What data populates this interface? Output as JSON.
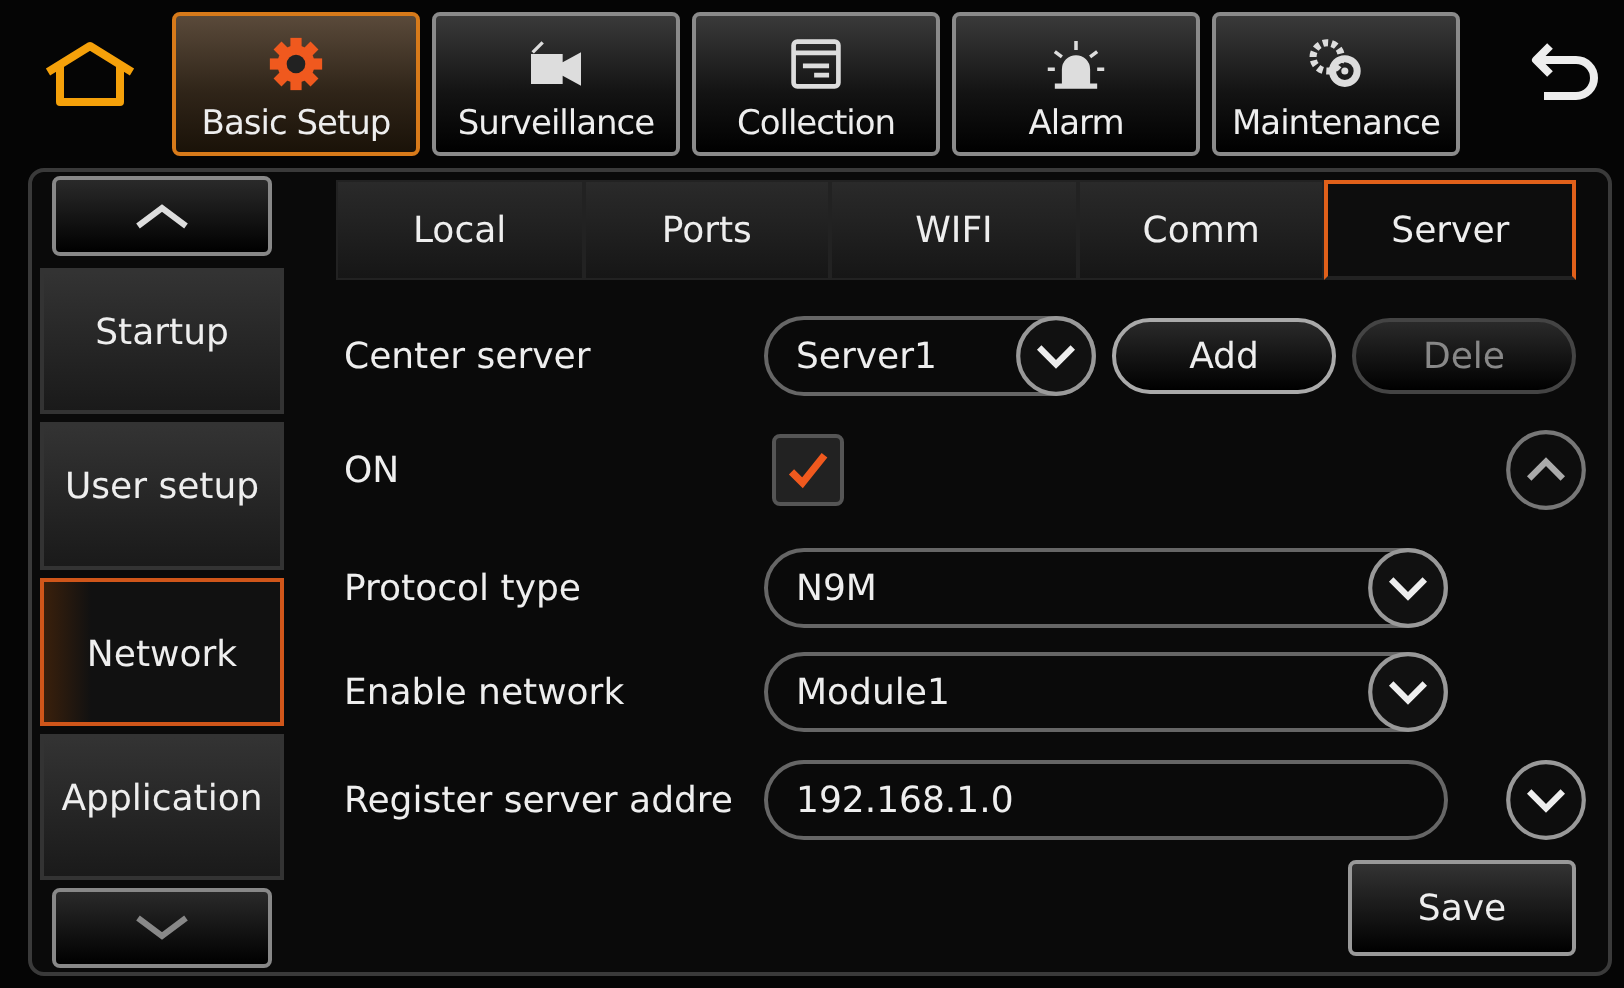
{
  "nav": [
    {
      "label": "Basic Setup",
      "selected": true
    },
    {
      "label": "Surveillance",
      "selected": false
    },
    {
      "label": "Collection",
      "selected": false
    },
    {
      "label": "Alarm",
      "selected": false
    },
    {
      "label": "Maintenance",
      "selected": false
    }
  ],
  "sidebar": {
    "items": [
      {
        "label": "Startup",
        "selected": false
      },
      {
        "label": "User setup",
        "selected": false
      },
      {
        "label": "Network",
        "selected": true
      },
      {
        "label": "Application",
        "selected": false
      }
    ]
  },
  "tabs": [
    {
      "label": "Local",
      "selected": false
    },
    {
      "label": "Ports",
      "selected": false
    },
    {
      "label": "WIFI",
      "selected": false
    },
    {
      "label": "Comm",
      "selected": false
    },
    {
      "label": "Server",
      "selected": true
    }
  ],
  "fields": [
    {
      "kind": "server",
      "label": "Center server",
      "value": "Server1",
      "buttons": [
        {
          "label": "Add",
          "disabled": false
        },
        {
          "label": "Dele",
          "disabled": true
        }
      ]
    },
    {
      "kind": "checkbox",
      "label": "ON",
      "checked": true
    },
    {
      "kind": "select",
      "label": "Protocol type",
      "value": "N9M"
    },
    {
      "kind": "select",
      "label": "Enable network",
      "value": "Module1"
    },
    {
      "kind": "text",
      "label": "Register server addre",
      "value": "192.168.1.0"
    }
  ],
  "save_button": "Save"
}
